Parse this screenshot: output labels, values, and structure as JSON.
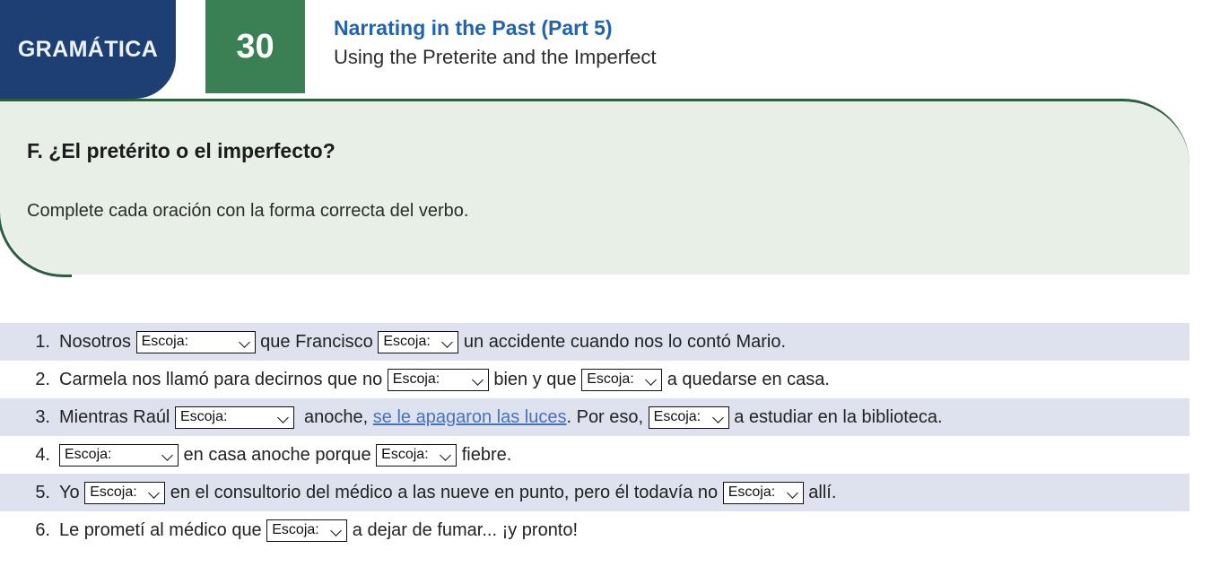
{
  "header": {
    "brand_label": "GRAMÁTICA",
    "chapter_number": "30",
    "title_main": "Narrating in the Past (Part 5)",
    "title_sub": "Using the Preterite and the Imperfect",
    "brand_color": "#1d3f73",
    "chapter_color": "#3a8055",
    "title_color": "#2263ad"
  },
  "panel": {
    "heading": "F. ¿El pretérito o el imperfecto?",
    "text": "Complete cada oración con la forma correcta del verbo.",
    "bg_color": "#e7efe6",
    "border_color": "#2c5e3f"
  },
  "select_placeholder": "Escoja:",
  "row_stripe_color": "#dde2ee",
  "link_color": "#4a72b8",
  "items": [
    {
      "number": "1.",
      "striped": true,
      "parts": [
        {
          "type": "text",
          "value": "Nosotros "
        },
        {
          "type": "select",
          "value": "Escoja:",
          "size": "wide"
        },
        {
          "type": "text",
          "value": " que Francisco "
        },
        {
          "type": "select",
          "value": "Escoja:",
          "size": "narrow"
        },
        {
          "type": "text",
          "value": " un accidente cuando nos lo contó Mario."
        }
      ]
    },
    {
      "number": "2.",
      "striped": false,
      "parts": [
        {
          "type": "text",
          "value": "Carmela nos llamó para decirnos que no "
        },
        {
          "type": "select",
          "value": "Escoja:",
          "size": "mid"
        },
        {
          "type": "text",
          "value": " bien y que "
        },
        {
          "type": "select",
          "value": "Escoja:",
          "size": "narrow"
        },
        {
          "type": "text",
          "value": " a quedarse en casa."
        }
      ]
    },
    {
      "number": "3.",
      "striped": true,
      "parts": [
        {
          "type": "text",
          "value": "Mientras Raúl "
        },
        {
          "type": "select",
          "value": "Escoja:",
          "size": "wide"
        },
        {
          "type": "text",
          "value": "  anoche, "
        },
        {
          "type": "link",
          "value": "se le apagaron las luces "
        },
        {
          "type": "text",
          "value": ". Por eso, "
        },
        {
          "type": "select",
          "value": "Escoja:",
          "size": "narrow"
        },
        {
          "type": "text",
          "value": " a estudiar en la biblioteca."
        }
      ]
    },
    {
      "number": "4.",
      "striped": false,
      "parts": [
        {
          "type": "select",
          "value": "Escoja:",
          "size": "wide"
        },
        {
          "type": "text",
          "value": " en casa anoche porque "
        },
        {
          "type": "select",
          "value": "Escoja:",
          "size": "narrow"
        },
        {
          "type": "text",
          "value": " fiebre."
        }
      ]
    },
    {
      "number": "5.",
      "striped": true,
      "parts": [
        {
          "type": "text",
          "value": "Yo "
        },
        {
          "type": "select",
          "value": "Escoja:",
          "size": "narrow"
        },
        {
          "type": "text",
          "value": " en el consultorio del médico a las nueve en punto, pero él todavía no "
        },
        {
          "type": "select",
          "value": "Escoja:",
          "size": "narrow"
        },
        {
          "type": "text",
          "value": " allí."
        }
      ]
    },
    {
      "number": "6.",
      "striped": false,
      "parts": [
        {
          "type": "text",
          "value": "Le prometí al médico que "
        },
        {
          "type": "select",
          "value": "Escoja:",
          "size": "narrow"
        },
        {
          "type": "text",
          "value": " a dejar de fumar... ¡y pronto!"
        }
      ]
    }
  ]
}
